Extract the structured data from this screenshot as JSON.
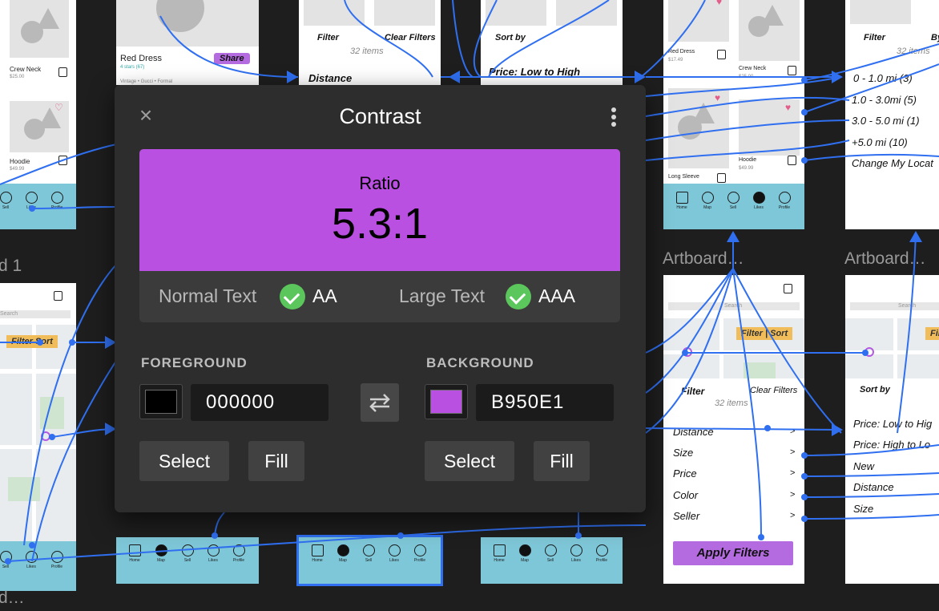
{
  "dialog": {
    "title": "Contrast",
    "ratio_label": "Ratio",
    "ratio_value": "5.3:1",
    "normal_text_label": "Normal Text",
    "normal_text_grade": "AA",
    "large_text_label": "Large Text",
    "large_text_grade": "AAA",
    "foreground": {
      "label": "FOREGROUND",
      "hex": "000000",
      "color": "#000000",
      "select_label": "Select",
      "fill_label": "Fill"
    },
    "background": {
      "label": "BACKGROUND",
      "hex": "B950E1",
      "color": "#B950E1",
      "select_label": "Select",
      "fill_label": "Fill"
    },
    "check_color": "#5bc65b"
  },
  "canvas": {
    "artboard_labels": [
      "Artboard…",
      "Artboard…",
      "d 1",
      "d…"
    ],
    "products": [
      {
        "name": "Crew Neck",
        "price": "$25.00"
      },
      {
        "name": "Hoodie",
        "price": "$49.99"
      },
      {
        "name": "Red Dress",
        "price": "$17.49"
      },
      {
        "name": "Crew Neck",
        "price": "$25.00"
      },
      {
        "name": "Long Sleeve",
        "price": ""
      },
      {
        "name": "Hoodie",
        "price": "$49.99"
      }
    ],
    "red_dress_card": {
      "name": "Red Dress",
      "stars": "4 stars (67)",
      "tags": "Vintage • Gucci • Formal",
      "share_label": "Share"
    },
    "filter_panel_top": {
      "title": "Filter",
      "clear_label": "Clear Filters",
      "count": "32 items",
      "row": "Distance"
    },
    "sort_panel_top": {
      "title": "Sort by",
      "row": "Price: Low to High"
    },
    "distance_panel": {
      "title": "Filter",
      "title2": "By",
      "count": "32 items",
      "rows": [
        "0 - 1.0 mi  (3)",
        "1.0 - 3.0mi  (5)",
        "3.0 - 5.0 mi  (1)",
        "+5.0 mi  (10)",
        "Change My Locat"
      ]
    },
    "map_board": {
      "search": "Search",
      "filter_label": "Filter",
      "sort_label": "Sort"
    },
    "map_board_right": {
      "search": "Search",
      "filter_label": "Filte"
    },
    "filter_panel": {
      "title": "Filter",
      "clear_label": "Clear Filters",
      "count": "32 items",
      "rows": [
        "Distance",
        "Size",
        "Price",
        "Color",
        "Seller"
      ],
      "apply_label": "Apply Filters"
    },
    "sort_panel": {
      "title": "Sort by",
      "rows": [
        "Price: Low to Hig",
        "Price: High to Lo",
        "New",
        "Distance",
        "Size"
      ]
    },
    "tab_labels": [
      "Home",
      "Map",
      "Sell",
      "Likes",
      "Profile"
    ],
    "left_search": "Search",
    "left_filter": "Filter",
    "left_sort": "Sort",
    "accent_wire": "#2f6ff0",
    "tabbar_color": "#7ec7d8"
  }
}
